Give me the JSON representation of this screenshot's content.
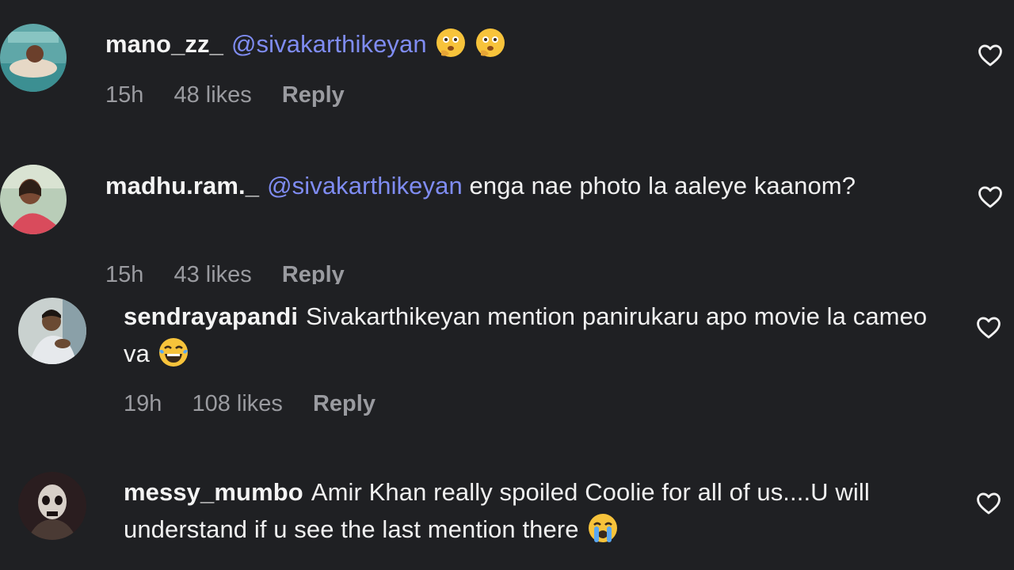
{
  "comments": [
    {
      "username": "mano_zz_",
      "mention": "@sivakarthikeyan",
      "text": "",
      "emojis": [
        "thinking-face",
        "thinking-face"
      ],
      "time": "15h",
      "likes": "48 likes",
      "reply": "Reply"
    },
    {
      "username": "madhu.ram._",
      "mention": "@sivakarthikeyan",
      "text": "enga nae photo la aaleye kaanom?",
      "emojis": [],
      "time": "15h",
      "likes": "43 likes",
      "reply": "Reply"
    },
    {
      "username": "sendrayapandi",
      "mention": "",
      "text": "Sivakarthikeyan mention panirukaru apo movie la cameo va",
      "emojis": [
        "laughing-tears-face"
      ],
      "time": "19h",
      "likes": "108 likes",
      "reply": "Reply"
    },
    {
      "username": "messy_mumbo",
      "mention": "",
      "text": "Amir Khan really spoiled Coolie for all of us....U will understand if u see the last mention there",
      "emojis": [
        "crying-face"
      ],
      "time": "",
      "likes": "",
      "reply": ""
    }
  ],
  "icons": {
    "like": "heart-outline-icon"
  },
  "colors": {
    "background": "#1f2023",
    "mention": "#7f8cf2",
    "meta": "#9a9ba0"
  }
}
